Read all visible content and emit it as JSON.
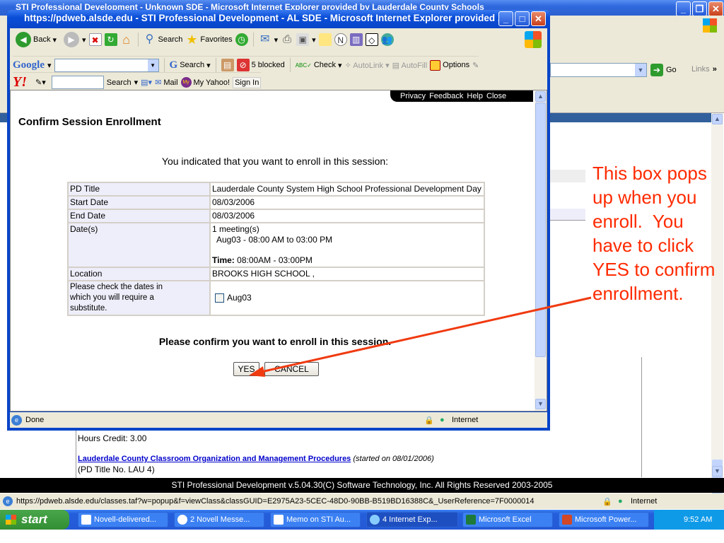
{
  "background_window": {
    "title": "STI Professional Development - Unknown SDE - Microsoft Internet Explorer provided by Lauderdale County Schools",
    "address_go": "Go",
    "links_label": "Links",
    "content": {
      "hours_credit": "Hours Credit: 3.00",
      "course_link": "Lauderdale County Classroom Organization and Management Procedures",
      "course_started": "(started on 08/01/2006)",
      "pd_title_no": "(PD Title No. LAU 4)"
    },
    "footer": "STI Professional Development v.5.04.30(C) Software Technology, Inc. All Rights Reserved 2003-2005",
    "status_url": "https://pdweb.alsde.edu/classes.taf?w=popup&f=viewClass&classGUID=E2975A23-5CEC-48D0-90BB-B519BD16388C&_UserReference=7F0000014",
    "status_zone": "Internet"
  },
  "popup": {
    "title": "https://pdweb.alsde.edu - STI Professional Development - AL SDE - Microsoft Internet Explorer provided ...",
    "toolbar": {
      "back": "Back",
      "search": "Search",
      "favorites": "Favorites"
    },
    "google_bar": {
      "logo": "Google",
      "search": "Search",
      "blocked": "5 blocked",
      "check": "Check",
      "autolink": "AutoLink",
      "autofill": "AutoFill",
      "options": "Options"
    },
    "yahoo_bar": {
      "logo": "Y!",
      "search": "Search",
      "mail": "Mail",
      "my_yahoo": "My Yahoo!",
      "sign_in": "Sign In"
    },
    "top_links": [
      "Privacy",
      "Feedback",
      "Help",
      "Close"
    ],
    "heading": "Confirm Session Enrollment",
    "intro": "You indicated that you want to enroll in this session:",
    "details": {
      "pd_title_label": "PD Title",
      "pd_title": "Lauderdale County System High School Professional Development Day",
      "start_date_label": "Start Date",
      "start_date": "08/03/2006",
      "end_date_label": "End Date",
      "end_date": "08/03/2006",
      "dates_label": "Date(s)",
      "meetings": "1 meeting(s)",
      "meeting_time": "Aug03 - 08:00 AM to 03:00 PM",
      "time_label": "Time:",
      "time_value": "08:00AM - 03:00PM",
      "location_label": "Location",
      "location": "BROOKS HIGH SCHOOL ,",
      "substitute_label": "Please check the dates in which you will require a substitute.",
      "substitute_date": "Aug03",
      "substitute_checked": false
    },
    "confirm_prompt": "Please confirm you want to enroll in this session.",
    "yes_button": "YES",
    "cancel_button": "CANCEL",
    "status_text": "Done",
    "status_zone": "Internet"
  },
  "annotation": {
    "text": "This box pops up when you enroll.  You have to click YES to confirm enrollment.",
    "color": "#ff2a00"
  },
  "taskbar": {
    "start": "start",
    "items": [
      "Novell-delivered...",
      "2 Novell Messe...",
      "Memo on STI Au...",
      "4 Internet Exp...",
      "Microsoft Excel",
      "Microsoft Power..."
    ],
    "clock": "9:52 AM"
  }
}
